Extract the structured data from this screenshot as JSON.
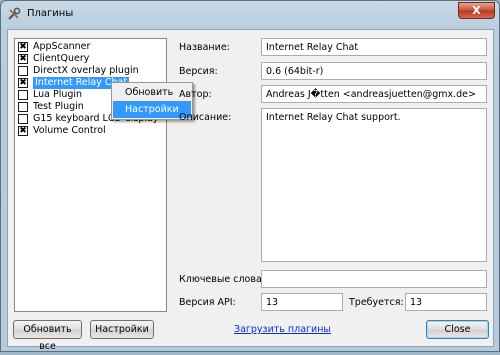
{
  "window": {
    "title": "Плагины",
    "close_glyph": "X",
    "title_icon": "wrench-screwdriver-icon"
  },
  "plugins": [
    {
      "name": "AppScanner",
      "checked": true
    },
    {
      "name": "ClientQuery",
      "checked": true
    },
    {
      "name": "DirectX overlay plugin",
      "checked": false
    },
    {
      "name": "Internet Relay Chat",
      "checked": true,
      "selected": true
    },
    {
      "name": "Lua Plugin",
      "checked": false
    },
    {
      "name": "Test Plugin",
      "checked": false
    },
    {
      "name": "G15 keyboard LCD display",
      "checked": false
    },
    {
      "name": "Volume Control",
      "checked": true
    }
  ],
  "check_glyph": "✖",
  "context_menu": {
    "items": [
      "Обновить",
      "Настройки"
    ],
    "highlighted": "Настройки"
  },
  "details": {
    "name_label": "Название:",
    "name_value": "Internet Relay Chat",
    "version_label": "Версия:",
    "version_value": "0.6 (64bit-r)",
    "author_label": "Автор:",
    "author_value": "Andreas J�tten <andreasjuetten@gmx.de>",
    "description_label": "Описание:",
    "description_value": "Internet Relay Chat support.",
    "keywords_label": "Ключевые слова:",
    "keywords_value": "",
    "api_label": "Версия API:",
    "api_value": "13",
    "requires_label": "Требуется:",
    "requires_value": "13"
  },
  "buttons": {
    "reload_all": "Обновить все",
    "settings": "Настройки",
    "close": "Close"
  },
  "links": {
    "download": "Загрузить плагины"
  },
  "colors": {
    "selection": "#3399ff",
    "link": "#0033cc",
    "close_button": "#c7523a"
  }
}
